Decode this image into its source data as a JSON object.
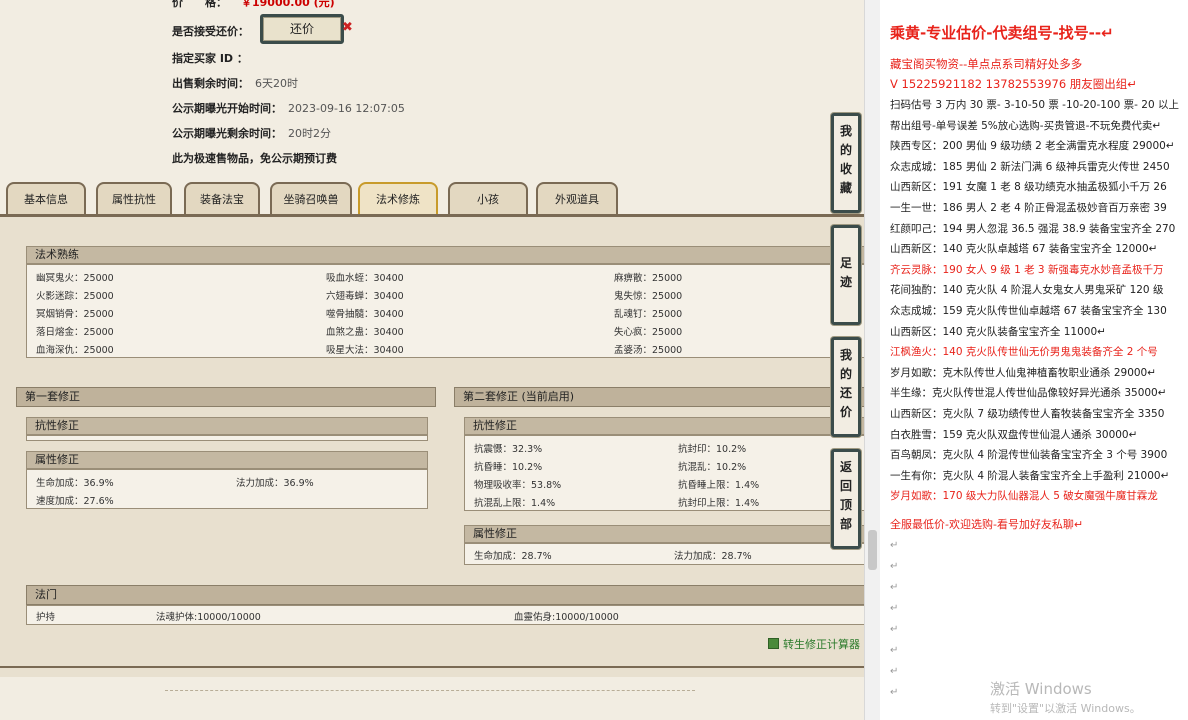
{
  "info": {
    "price_label": "价　　格：",
    "price_value": "￥19000.00 (元)",
    "accept_haggle_label": "是否接受还价：",
    "haggle_button": "还价",
    "haggle_close": "✖",
    "buyer_id_label": "指定买家 ID ：",
    "remaining_label": "出售剩余时间：",
    "remaining_value": "6天20时",
    "public_start_label": "公示期曝光开始时间：",
    "public_start_value": "2023-09-16 12:07:05",
    "public_remaining_label": "公示期曝光剩余时间：",
    "public_remaining_value": "20时2分",
    "note": "此为极速售物品，免公示期预订费"
  },
  "tabs": [
    "基本信息",
    "属性抗性",
    "装备法宝",
    "坐骑召唤兽",
    "法术修炼",
    "小孩",
    "外观道具"
  ],
  "active_tab": "法术修炼",
  "skills": {
    "header": "法术熟练",
    "rows": [
      [
        "幽冥鬼火：25000",
        "吸血水蛭：30400",
        "麻痹散：25000"
      ],
      [
        "火影迷踪：25000",
        "六翅毒蝉：30400",
        "鬼失惊：25000"
      ],
      [
        "冥烟销骨：25000",
        "噬骨抽髓：30400",
        "乱魂钉：25000"
      ],
      [
        "落日熔金：25000",
        "血煞之蛊：30400",
        "失心疯：25000"
      ],
      [
        "血海深仇：25000",
        "吸星大法：30400",
        "孟婆汤：25000"
      ]
    ]
  },
  "set1": {
    "header": "第一套修正",
    "resist_header": "抗性修正",
    "attr_header": "属性修正",
    "attrs": [
      "生命加成：36.9%",
      "法力加成：36.9%",
      "速度加成：27.6%"
    ]
  },
  "set2": {
    "header": "第二套修正 (当前启用)",
    "resist_header": "抗性修正",
    "resists": [
      [
        "抗震慑：32.3%",
        "抗封印：10.2%"
      ],
      [
        "抗昏睡：10.2%",
        "抗混乱：10.2%"
      ],
      [
        "物理吸收率：53.8%",
        "抗昏睡上限：1.4%"
      ],
      [
        "抗混乱上限：1.4%",
        "抗封印上限：1.4%"
      ]
    ],
    "attr_header": "属性修正",
    "attrs": [
      "生命加成：28.7%",
      "法力加成：28.7%"
    ]
  },
  "fashu": {
    "header": "法门",
    "items": [
      "护持",
      "法魂护体:10000/10000",
      "血靈佑身:10000/10000"
    ]
  },
  "float_buttons": [
    [
      "我",
      "的",
      "收",
      "藏"
    ],
    [
      "足",
      "迹"
    ],
    [
      "我",
      "的",
      "还",
      "价"
    ],
    [
      "返",
      "回",
      "顶",
      "部"
    ]
  ],
  "calc_link": "转生修正计算器",
  "doc": {
    "title": "乘黄-专业估价-代卖组号-找号--↵",
    "line2": "藏宝阁买物资--单点点系司精好处多多",
    "line3": "V 15225921182   13782553976 朋友圈出组↵",
    "lines": [
      {
        "t": "扫码估号 3 万内 30 票- 3-10-50 票  -10-20-100 票- 20 以上",
        "red": false
      },
      {
        "t": "帮出组号-单号误差 5%放心选购-买贵管退-不玩免费代卖↵",
        "red": false
      },
      {
        "t": "陕西专区：200 男仙 9 级功绩 2 老全满雷克水程度 29000↵",
        "red": false
      },
      {
        "t": "众志成城：185 男仙 2 新法门满 6 级神兵雷克火传世 2450",
        "red": false
      },
      {
        "t": "山西新区：191 女魔 1 老 8 级功绩克水抽孟极狐小千万 26",
        "red": false
      },
      {
        "t": "一生一世：186 男人 2 老 4 阶正骨混孟极妙音百万亲密 39",
        "red": false
      },
      {
        "t": "红颜叩己：194 男人忽混 36.5 强混 38.9 装备宝宝齐全 270",
        "red": false
      },
      {
        "t": "山西新区：140 克火队卓越塔 67 装备宝宝齐全 12000↵",
        "red": false
      },
      {
        "t": "齐云灵脉：190 女人 9 级 1 老 3 新强毒克水妙音孟极千万",
        "red": true
      },
      {
        "t": "花间独酌：140 克火队 4 阶混人女鬼女人男鬼采矿 120 级",
        "red": false
      },
      {
        "t": "众志成城：159 克火队传世仙卓越塔 67 装备宝宝齐全 130",
        "red": false
      },
      {
        "t": "山西新区：140 克火队装备宝宝齐全 11000↵",
        "red": false
      },
      {
        "t": "江枫渔火：140 克火队传世仙无价男鬼鬼装备齐全 2 个号",
        "red": true
      },
      {
        "t": "岁月如歌：克木队传世人仙鬼神植畜牧职业通杀 29000↵",
        "red": false
      },
      {
        "t": "半生缘：克火队传世混人传世仙品像较好异光通杀 35000↵",
        "red": false
      },
      {
        "t": "山西新区：克火队 7 级功绩传世人畜牧装备宝宝齐全 3350",
        "red": false
      },
      {
        "t": "白衣胜雪：159 克火队双盘传世仙混人通杀 30000↵",
        "red": false
      },
      {
        "t": "百鸟朝凤：克火队 4 阶混传世仙装备宝宝齐全 3 个号 3900",
        "red": false
      },
      {
        "t": "一生有你：克火队 4 阶混人装备宝宝齐全上手盈利 21000↵",
        "red": false
      },
      {
        "t": "岁月如歌：170 级大力队仙器混人 5 破女魔强牛魔甘霖龙",
        "red": true
      }
    ],
    "closing": "全服最低价-欢迎选购-看号加好友私聊↵",
    "empty_marks": [
      "↵",
      "↵",
      "↵",
      "↵",
      "↵",
      "↵",
      "↵",
      "↵"
    ],
    "activate_title": "激活 Windows",
    "activate_sub": "转到\"设置\"以激活 Windows。"
  }
}
